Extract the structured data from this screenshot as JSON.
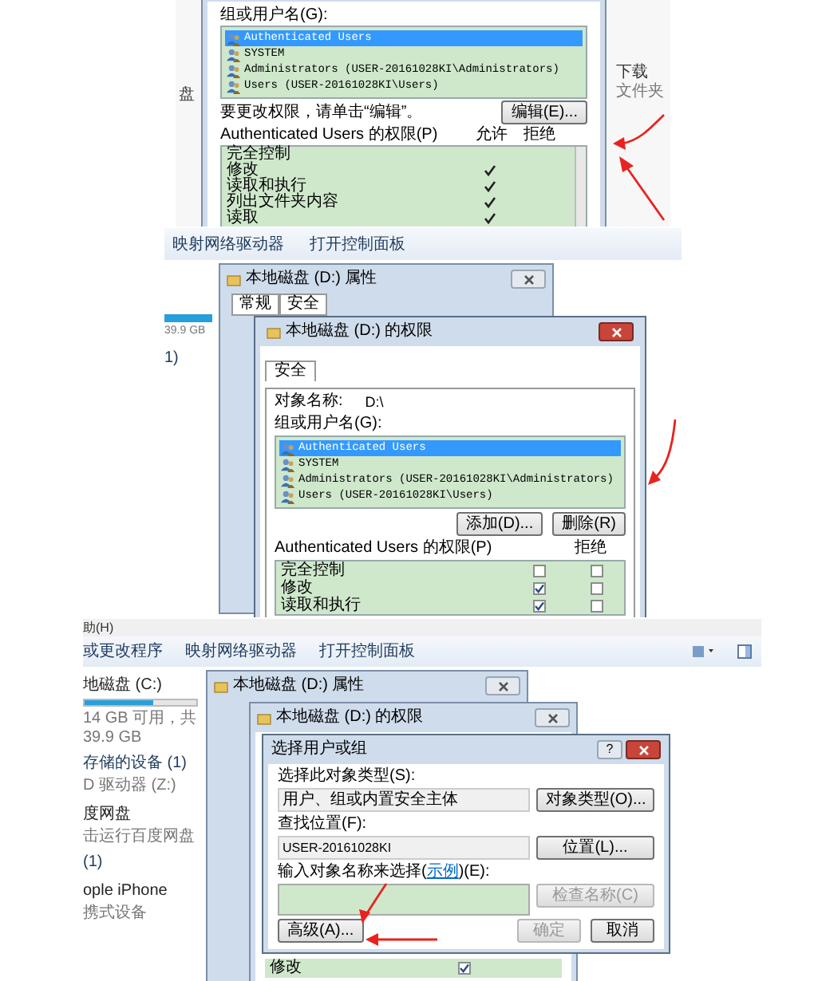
{
  "shot1": {
    "left_label": "盘",
    "right_labels": [
      "下载",
      "文件夹"
    ],
    "group_label": "组或用户名(G):",
    "users": [
      {
        "name": "Authenticated Users",
        "selected": true
      },
      {
        "name": "SYSTEM",
        "selected": false
      },
      {
        "name": "Administrators (USER-20161028KI\\Administrators)",
        "selected": false
      },
      {
        "name": "Users (USER-20161028KI\\Users)",
        "selected": false
      }
    ],
    "hint": "要更改权限，请单击“编辑”。",
    "edit_button": "编辑(E)...",
    "perm_label": "Authenticated Users 的权限(P)",
    "allow_header": "允许",
    "deny_header": "拒绝",
    "permissions": [
      {
        "name": "完全控制",
        "allow": false
      },
      {
        "name": "修改",
        "allow": true
      },
      {
        "name": "读取和执行",
        "allow": true
      },
      {
        "name": "列出文件夹内容",
        "allow": true
      },
      {
        "name": "读取",
        "allow": true
      }
    ]
  },
  "shot2": {
    "toolbar": [
      "映射网络驱动器",
      "打开控制面板"
    ],
    "drive_size": "39.9 GB",
    "group_count": "1)",
    "props_title": "本地磁盘 (D:) 属性",
    "props_tabs": [
      "常规",
      "安全"
    ],
    "perm_title": "本地磁盘 (D:) 的权限",
    "perm_tab": "安全",
    "object_label": "对象名称:",
    "object_value": "D:\\",
    "group_label": "组或用户名(G):",
    "users": [
      {
        "name": "Authenticated Users",
        "selected": true
      },
      {
        "name": "SYSTEM",
        "selected": false
      },
      {
        "name": "Administrators (USER-20161028KI\\Administrators)",
        "selected": false
      },
      {
        "name": "Users (USER-20161028KI\\Users)",
        "selected": false
      }
    ],
    "add_button": "添加(D)...",
    "remove_button": "删除(R)",
    "perm_label": "Authenticated Users 的权限(P)",
    "deny_header": "拒绝",
    "permissions": [
      {
        "name": "完全控制",
        "allow": false,
        "deny": false
      },
      {
        "name": "修改",
        "allow": true,
        "deny": false
      },
      {
        "name": "读取和执行",
        "allow": true,
        "deny": false
      }
    ]
  },
  "shot3": {
    "menu": "助(H)",
    "toolbar": [
      "或更改程序",
      "映射网络驱动器",
      "打开控制面板"
    ],
    "sidebar": [
      {
        "kind": "title",
        "text": "地磁盘 (C:)"
      },
      {
        "kind": "bar",
        "level": 0.62
      },
      {
        "kind": "text",
        "text": "14 GB 可用，共 39.9 GB"
      },
      {
        "kind": "heading",
        "text": "存储的设备 (1)"
      },
      {
        "kind": "text",
        "text": "D 驱动器 (Z:)"
      },
      {
        "kind": "title",
        "text": "度网盘"
      },
      {
        "kind": "text",
        "text": "击运行百度网盘"
      },
      {
        "kind": "heading",
        "text": "(1)"
      },
      {
        "kind": "title",
        "text": "ople iPhone"
      },
      {
        "kind": "text",
        "text": "携式设备"
      }
    ],
    "props_title": "本地磁盘 (D:) 属性",
    "perm_title": "本地磁盘 (D:) 的权限",
    "dialog_title": "选择用户或组",
    "help_button": "?",
    "type_label": "选择此对象类型(S):",
    "type_value": "用户、组或内置安全主体",
    "type_button": "对象类型(O)...",
    "location_label": "查找位置(F):",
    "location_value": "USER-20161028KI",
    "location_button": "位置(L)...",
    "names_label": "输入对象名称来选择(",
    "names_link": "示例",
    "names_label_end": ")(E):",
    "check_button": {
      "label": "检查名称(C)",
      "disabled": true
    },
    "advanced_button": "高级(A)...",
    "ok_button": {
      "label": "确定",
      "disabled": true
    },
    "cancel_button": "取消",
    "perm_row": {
      "name": "修改",
      "allow": true
    }
  }
}
